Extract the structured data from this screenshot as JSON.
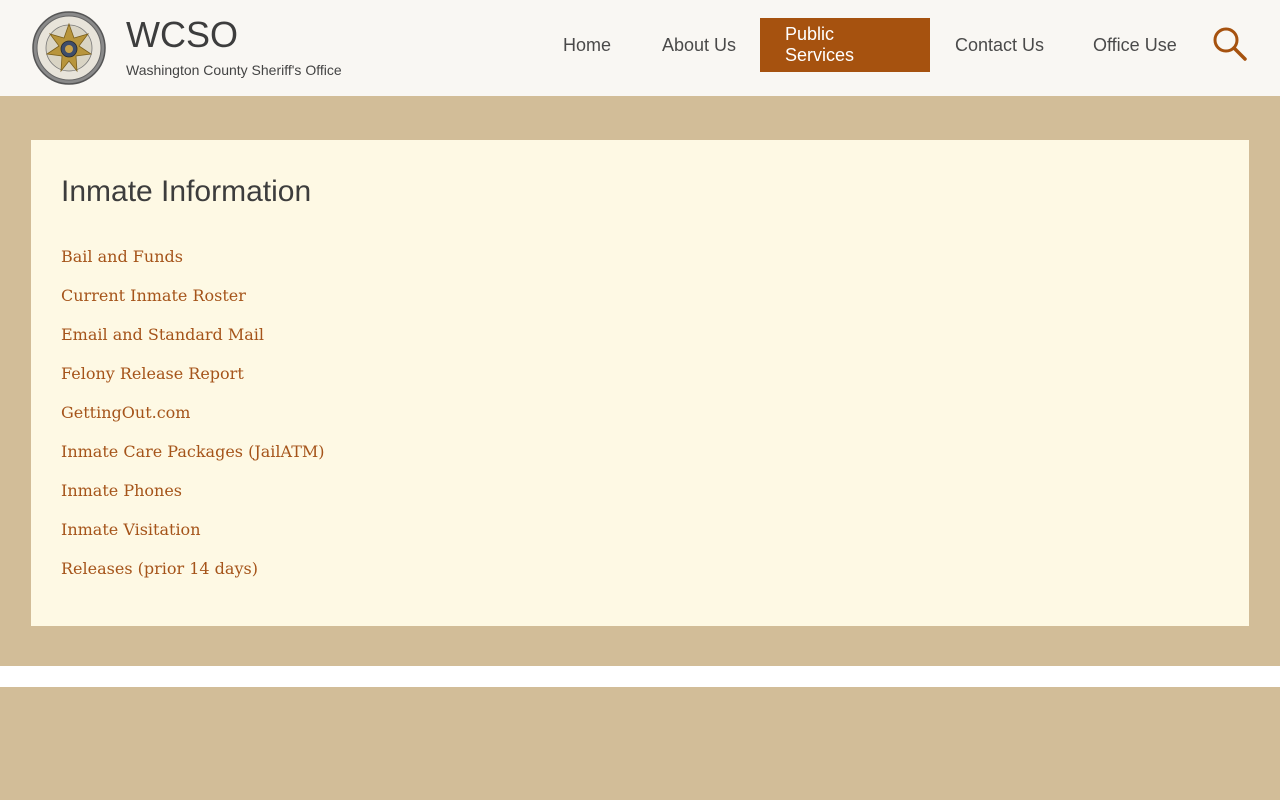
{
  "site": {
    "title": "WCSO",
    "subtitle": "Washington County Sheriff's Office",
    "seal_text": "WASHINGTON COUNTY SHERIFF"
  },
  "nav": {
    "items": [
      {
        "label": "Home",
        "active": false
      },
      {
        "label": "About Us",
        "active": false
      },
      {
        "label": "Public Services",
        "active": true
      },
      {
        "label": "Contact Us",
        "active": false
      },
      {
        "label": "Office Use",
        "active": false
      }
    ],
    "search_icon": "search-icon"
  },
  "main": {
    "heading": "Inmate Information",
    "links": [
      "Bail and Funds",
      "Current Inmate Roster",
      "Email and Standard Mail",
      "Felony Release Report",
      "GettingOut.com",
      "Inmate Care Packages (JailATM)",
      "Inmate Phones",
      "Inmate Visitation",
      "Releases (prior 14 days)"
    ]
  },
  "colors": {
    "accent": "#a6520f",
    "link": "#a5541a",
    "page_bg": "#d2bd98",
    "card_bg": "#fef9e4",
    "header_bg": "#f9f7f3"
  }
}
